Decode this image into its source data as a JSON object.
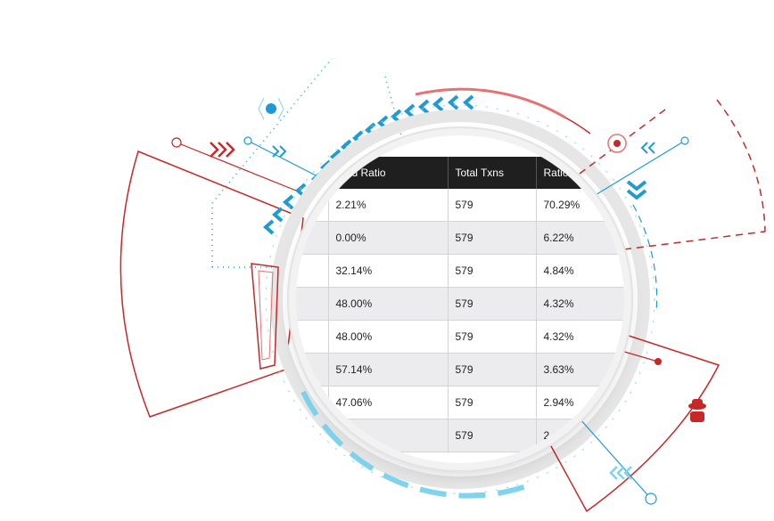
{
  "table": {
    "columns": [
      "cted Ratio",
      "Total Txns",
      "Ratio"
    ],
    "rows": [
      [
        "2.21%",
        "579",
        "70.29%"
      ],
      [
        "0.00%",
        "579",
        "6.22%"
      ],
      [
        "32.14%",
        "579",
        "4.84%"
      ],
      [
        "48.00%",
        "579",
        "4.32%"
      ],
      [
        "48.00%",
        "579",
        "4.32%"
      ],
      [
        "57.14%",
        "579",
        "3.63%"
      ],
      [
        "47.06%",
        "579",
        "2.94%"
      ],
      [
        "",
        "579",
        "2"
      ]
    ]
  },
  "colors": {
    "accent_blue": "#1e9bd3",
    "light_blue": "#7fd3ec",
    "accent_red": "#c62828",
    "light_red": "#e57373",
    "header_bg": "#1f1f1f",
    "row_alt_bg": "#ececee"
  },
  "decor": {
    "icons": [
      "chevron-left-icon",
      "chevron-right-icon",
      "chevron-down-icon",
      "target-dot-icon",
      "hacker-icon"
    ]
  }
}
